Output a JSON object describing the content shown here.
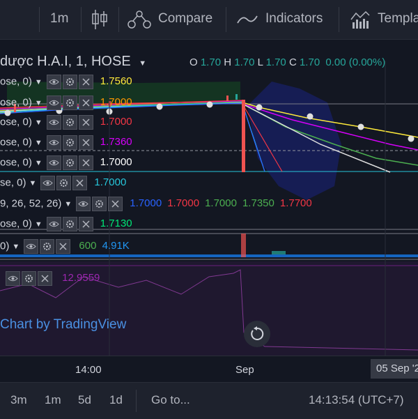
{
  "toolbar": {
    "interval": "1m",
    "compare_label": "Compare",
    "indicators_label": "Indicators",
    "templates_label": "Templa"
  },
  "symbol": {
    "title": "dược H.A.I, 1, HOSE",
    "ohlc": {
      "o_label": "O",
      "o": "1.70",
      "h_label": "H",
      "h": "1.70",
      "l_label": "L",
      "l": "1.70",
      "c_label": "C",
      "c": "1.70",
      "change": "0.00 (0.00%)"
    }
  },
  "indicators": [
    {
      "params": "ose, 0)",
      "values": [
        {
          "v": "1.7560",
          "color": "#ffeb3b"
        }
      ]
    },
    {
      "params": "ose, 0)",
      "values": [
        {
          "v": "1.7000",
          "color": "#ff9800"
        }
      ]
    },
    {
      "params": "ose, 0)",
      "values": [
        {
          "v": "1.7000",
          "color": "#f23645"
        }
      ]
    },
    {
      "params": "ose, 0)",
      "values": [
        {
          "v": "1.7360",
          "color": "#d500f9"
        }
      ]
    },
    {
      "params": "ose, 0)",
      "values": [
        {
          "v": "1.7000",
          "color": "#ffffff"
        }
      ]
    },
    {
      "params": "se, 0)",
      "values": [
        {
          "v": "1.7000",
          "color": "#26c6da"
        }
      ]
    },
    {
      "params": "9, 26, 52, 26)",
      "values": [
        {
          "v": "1.7000",
          "color": "#2962ff"
        },
        {
          "v": "1.7000",
          "color": "#f23645"
        },
        {
          "v": "1.7000",
          "color": "#4caf50"
        },
        {
          "v": "1.7350",
          "color": "#4caf50"
        },
        {
          "v": "1.7700",
          "color": "#f23645"
        }
      ]
    },
    {
      "params": "ose, 0)",
      "values": [
        {
          "v": "1.7130",
          "color": "#00e676"
        }
      ]
    }
  ],
  "volume": {
    "params": "0)",
    "v1": "600",
    "v1_color": "#4caf50",
    "v2": "4.91K",
    "v2_color": "#2196f3"
  },
  "rsi": {
    "value": "12.9559",
    "color": "#9c27b0"
  },
  "watermark": "Chart by TradingView",
  "time_axis": {
    "labels": [
      "14:00",
      "Sep"
    ],
    "crosshair_label": "05 Sep '2"
  },
  "bottombar": {
    "ranges": [
      "3m",
      "1m",
      "5d",
      "1d"
    ],
    "goto_label": "Go to...",
    "clock": "14:13:54 (UTC+7)"
  },
  "icons": {
    "candles": "candles-icon",
    "compare": "compare-icon",
    "indicators": "indicators-icon",
    "templates": "templates-icon",
    "eye": "eye-icon",
    "gear": "gear-icon",
    "close": "close-icon",
    "reset": "reset-icon"
  },
  "colors": {
    "background": "#131722",
    "toolbar": "#1e222d",
    "up": "#26a69a",
    "down": "#ef5350",
    "rsi_fill": "#2a1a3a"
  }
}
